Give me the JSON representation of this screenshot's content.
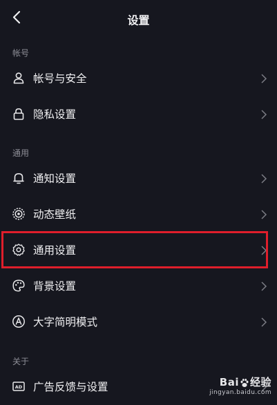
{
  "header": {
    "title": "设置"
  },
  "sections": [
    {
      "label": "帐号"
    },
    {
      "label": "通用"
    },
    {
      "label": "关于"
    }
  ],
  "items": [
    {
      "label": "帐号与安全",
      "icon": "user-icon"
    },
    {
      "label": "隐私设置",
      "icon": "lock-icon"
    },
    {
      "label": "通知设置",
      "icon": "bell-icon"
    },
    {
      "label": "动态壁纸",
      "icon": "live-wallpaper-icon"
    },
    {
      "label": "通用设置",
      "icon": "gear-icon"
    },
    {
      "label": "背景设置",
      "icon": "palette-icon"
    },
    {
      "label": "大字简明模式",
      "icon": "font-size-icon"
    },
    {
      "label": "广告反馈与设置",
      "icon": "ad-icon"
    }
  ],
  "colors": {
    "background": "#16171f",
    "highlight": "#e01e2b",
    "section_text": "#8d8e96"
  },
  "watermark": {
    "brand_prefix": "Bai",
    "brand_suffix": "经验",
    "url": "jingyan.baidu.com"
  }
}
